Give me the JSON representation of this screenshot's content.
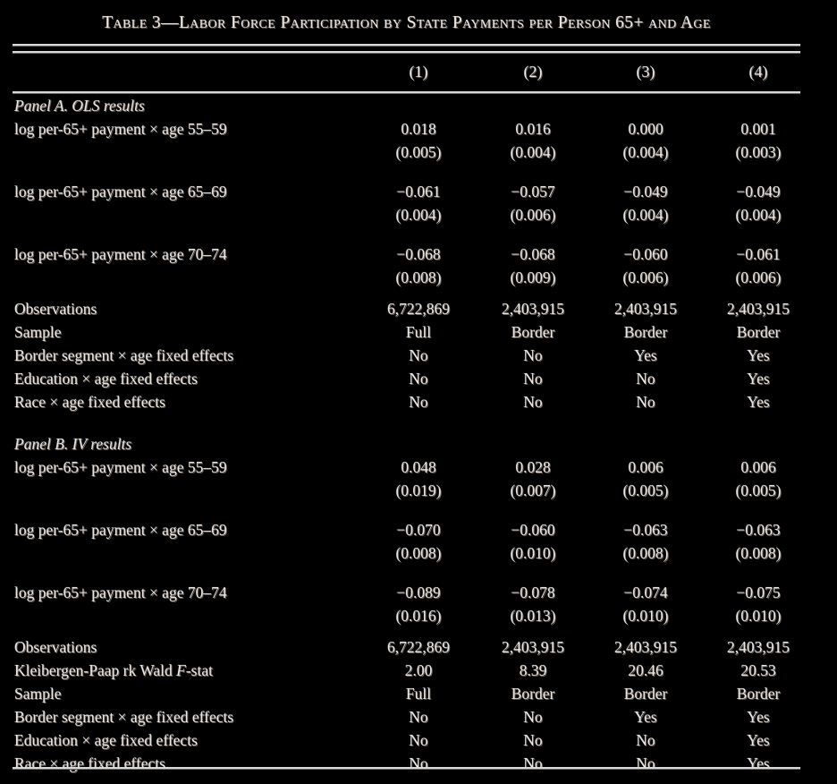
{
  "title": "Table 3—Labor Force Participation by State Payments per Person 65+ and Age",
  "column_headers": [
    "(1)",
    "(2)",
    "(3)",
    "(4)"
  ],
  "panel_a": {
    "heading": "Panel A. OLS results",
    "coef_rows": [
      {
        "label": "log per-65+ payment × age 55–59",
        "coefs": [
          "0.018",
          "0.016",
          "0.000",
          "0.001"
        ],
        "ses": [
          "(0.005)",
          "(0.004)",
          "(0.004)",
          "(0.003)"
        ]
      },
      {
        "label": "log per-65+ payment  × age 65–69",
        "coefs": [
          "−0.061",
          "−0.057",
          "−0.049",
          "−0.049"
        ],
        "ses": [
          "(0.004)",
          "(0.006)",
          "(0.004)",
          "(0.004)"
        ]
      },
      {
        "label": "log per-65+ payment × age 70–74",
        "coefs": [
          "−0.068",
          "−0.068",
          "−0.060",
          "−0.061"
        ],
        "ses": [
          "(0.008)",
          "(0.009)",
          "(0.006)",
          "(0.006)"
        ]
      }
    ],
    "stat_rows": [
      {
        "label": "Observations",
        "values": [
          "6,722,869",
          "2,403,915",
          "2,403,915",
          "2,403,915"
        ]
      },
      {
        "label": "Sample",
        "values": [
          "Full",
          "Border",
          "Border",
          "Border"
        ]
      },
      {
        "label": "Border segment × age fixed effects",
        "values": [
          "No",
          "No",
          "Yes",
          "Yes"
        ]
      },
      {
        "label": "Education × age fixed effects",
        "values": [
          "No",
          "No",
          "No",
          "Yes"
        ]
      },
      {
        "label": "Race × age fixed effects",
        "values": [
          "No",
          "No",
          "No",
          "Yes"
        ]
      }
    ]
  },
  "panel_b": {
    "heading": "Panel B. IV results",
    "coef_rows": [
      {
        "label": "log per-65+ payment  × age 55–59",
        "coefs": [
          "0.048",
          "0.028",
          "0.006",
          "0.006"
        ],
        "ses": [
          "(0.019)",
          "(0.007)",
          "(0.005)",
          "(0.005)"
        ]
      },
      {
        "label": "log per-65+ payment × age 65–69",
        "coefs": [
          "−0.070",
          "−0.060",
          "−0.063",
          "−0.063"
        ],
        "ses": [
          "(0.008)",
          "(0.010)",
          "(0.008)",
          "(0.008)"
        ]
      },
      {
        "label": "log per-65+ payment × age 70–74",
        "coefs": [
          "−0.089",
          "−0.078",
          "−0.074",
          "−0.075"
        ],
        "ses": [
          "(0.016)",
          "(0.013)",
          "(0.010)",
          "(0.010)"
        ]
      }
    ],
    "stat_rows": [
      {
        "label": "Observations",
        "values": [
          "6,722,869",
          "2,403,915",
          "2,403,915",
          "2,403,915"
        ]
      },
      {
        "label_pre": "Kleibergen-Paap rk Wald ",
        "label_italic": "F",
        "label_post": "-stat",
        "label": "Kleibergen-Paap rk Wald F-stat",
        "values": [
          "2.00",
          "8.39",
          "20.46",
          "20.53"
        ]
      },
      {
        "label": "Sample",
        "values": [
          "Full",
          "Border",
          "Border",
          "Border"
        ]
      },
      {
        "label": "Border segment × age fixed effects",
        "values": [
          "No",
          "No",
          "Yes",
          "Yes"
        ]
      },
      {
        "label": "Education × age fixed effects",
        "values": [
          "No",
          "No",
          "No",
          "Yes"
        ]
      },
      {
        "label": "Race × age fixed effects",
        "values": [
          "No",
          "No",
          "No",
          "Yes"
        ]
      }
    ]
  }
}
